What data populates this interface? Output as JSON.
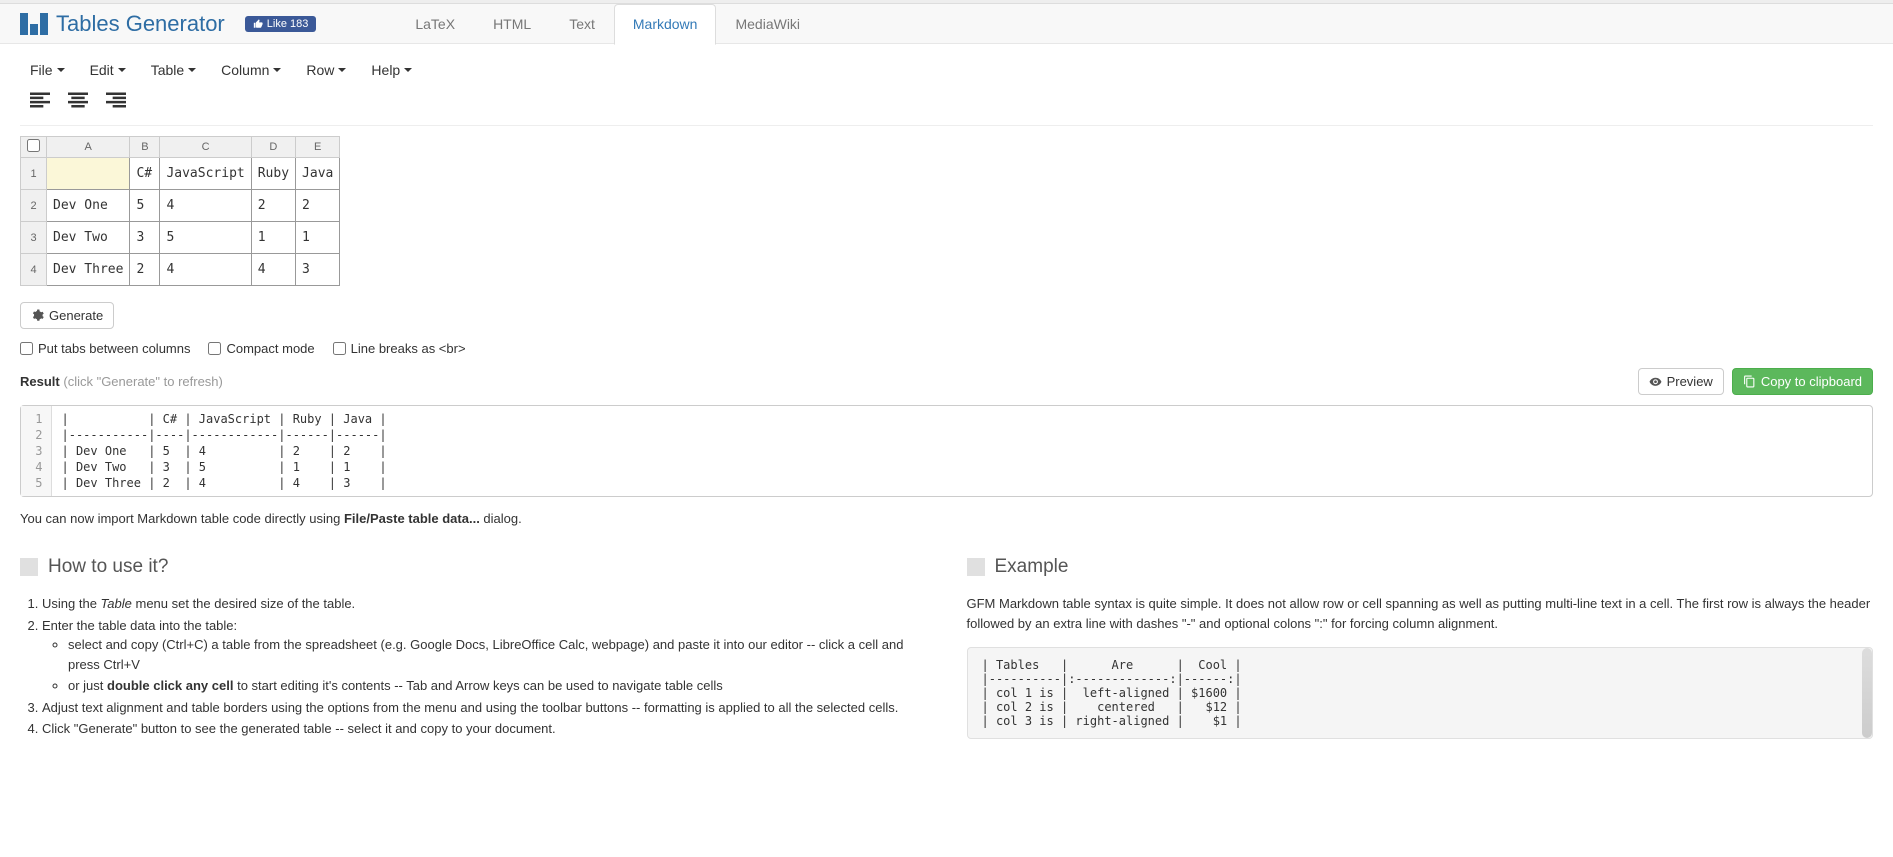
{
  "brand": {
    "name": "Tables Generator",
    "fb_like": "Like 183"
  },
  "nav_tabs": [
    "LaTeX",
    "HTML",
    "Text",
    "Markdown",
    "MediaWiki"
  ],
  "active_tab": "Markdown",
  "menus": [
    "File",
    "Edit",
    "Table",
    "Column",
    "Row",
    "Help"
  ],
  "sheet": {
    "cols": [
      "A",
      "B",
      "C",
      "D",
      "E"
    ],
    "rows": [
      {
        "n": "1",
        "cells": [
          "",
          "C#",
          "JavaScript",
          "Ruby",
          "Java"
        ]
      },
      {
        "n": "2",
        "cells": [
          "Dev One",
          "5",
          "4",
          "2",
          "2"
        ]
      },
      {
        "n": "3",
        "cells": [
          "Dev Two",
          "3",
          "5",
          "1",
          "1"
        ]
      },
      {
        "n": "4",
        "cells": [
          "Dev Three",
          "2",
          "4",
          "4",
          "3"
        ]
      }
    ],
    "selected": {
      "row": 0,
      "col": 0
    }
  },
  "generate_label": "Generate",
  "options": {
    "tabs_label": "Put tabs between columns",
    "compact_label": "Compact mode",
    "br_label": "Line breaks as <br>"
  },
  "result": {
    "label": "Result",
    "hint": "(click \"Generate\" to refresh)",
    "preview_label": "Preview",
    "copy_label": "Copy to clipboard",
    "lines": [
      "|           | C# | JavaScript | Ruby | Java |",
      "|-----------|----|------------|------|------|",
      "| Dev One   | 5  | 4          | 2    | 2    |",
      "| Dev Two   | 3  | 5          | 1    | 1    |",
      "| Dev Three | 2  | 4          | 4    | 3    |"
    ]
  },
  "import_note": {
    "pre": "You can now import Markdown table code directly using ",
    "bold": "File/Paste table data...",
    "post": " dialog."
  },
  "howto": {
    "title": "How to use it?",
    "item1_pre": "Using the ",
    "item1_em": "Table",
    "item1_post": " menu set the desired size of the table.",
    "item2": "Enter the table data into the table:",
    "item2a": "select and copy (Ctrl+C) a table from the spreadsheet (e.g. Google Docs, LibreOffice Calc, webpage) and paste it into our editor -- click a cell and press Ctrl+V",
    "item2b_pre": "or just ",
    "item2b_bold": "double click any cell",
    "item2b_post": " to start editing it's contents -- Tab and Arrow keys can be used to navigate table cells",
    "item3": "Adjust text alignment and table borders using the options from the menu and using the toolbar buttons -- formatting is applied to all the selected cells.",
    "item4": "Click \"Generate\" button to see the generated table -- select it and copy to your document."
  },
  "example": {
    "title": "Example",
    "text": "GFM Markdown table syntax is quite simple. It does not allow row or cell spanning as well as putting multi-line text in a cell. The first row is always the header followed by an extra line with dashes \"-\" and optional colons \":\" for forcing column alignment.",
    "code": "| Tables   |      Are      |  Cool |\n|----------|:-------------:|------:|\n| col 1 is |  left-aligned | $1600 |\n| col 2 is |    centered   |   $12 |\n| col 3 is | right-aligned |    $1 |"
  }
}
